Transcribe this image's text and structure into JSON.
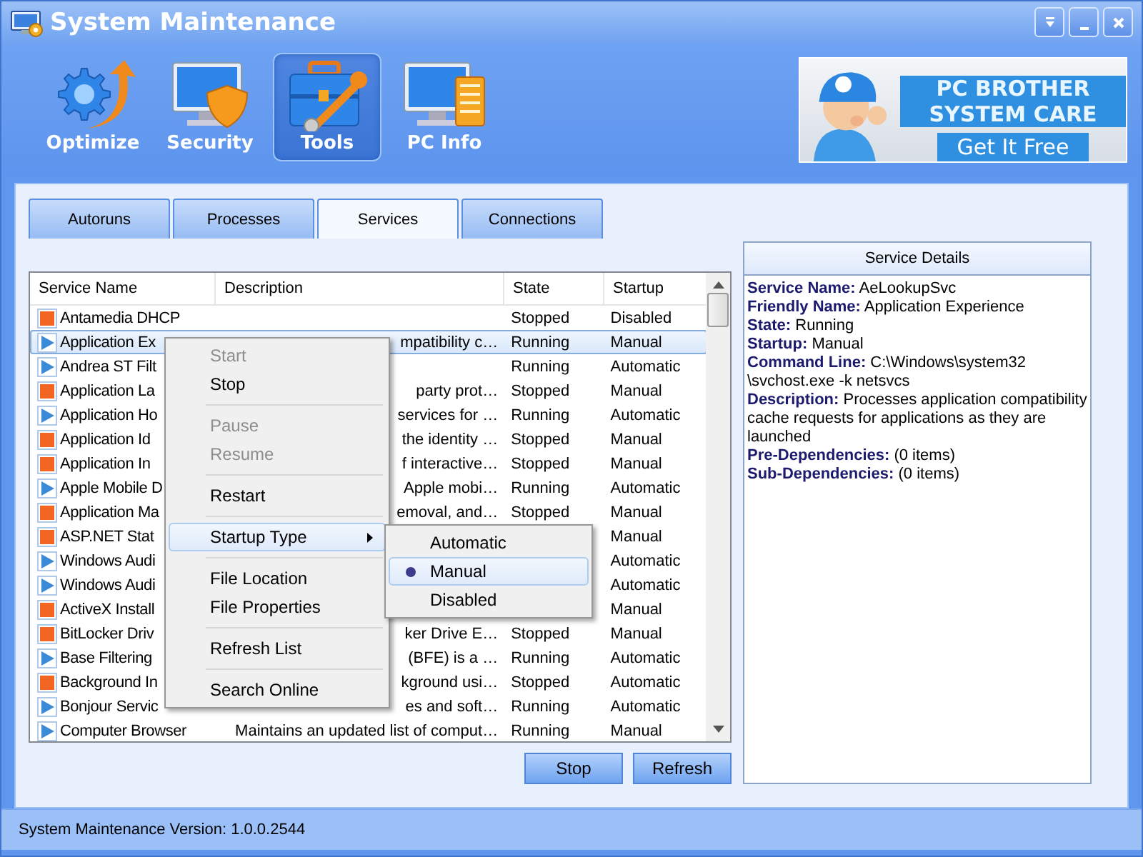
{
  "window": {
    "title": "System Maintenance"
  },
  "nav": [
    {
      "label": "Optimize",
      "kind": "optimize",
      "selected": false
    },
    {
      "label": "Security",
      "kind": "security",
      "selected": false
    },
    {
      "label": "Tools",
      "kind": "tools",
      "selected": true
    },
    {
      "label": "PC Info",
      "kind": "info",
      "selected": false
    }
  ],
  "banner": {
    "title_lines": [
      "PC BROTHER",
      "SYSTEM CARE"
    ],
    "action": "Get It Free"
  },
  "tabs": [
    {
      "label": "Autoruns",
      "selected": false
    },
    {
      "label": "Processes",
      "selected": false
    },
    {
      "label": "Services",
      "selected": true
    },
    {
      "label": "Connections",
      "selected": false
    }
  ],
  "table": {
    "columns": [
      "Service Name",
      "Description",
      "State",
      "Startup"
    ],
    "rows": [
      {
        "running": false,
        "selected": false,
        "name": "Antamedia DHCP",
        "state": "Stopped",
        "startup": "Disabled"
      },
      {
        "running": true,
        "selected": true,
        "name": "Application Ex",
        "description": "mpatibility c…",
        "state": "Running",
        "startup": "Manual"
      },
      {
        "running": true,
        "selected": false,
        "name": "Andrea ST Filt",
        "state": "Running",
        "startup": "Automatic"
      },
      {
        "running": false,
        "selected": false,
        "name": "Application La",
        "description": "party prot…",
        "state": "Stopped",
        "startup": "Manual"
      },
      {
        "running": true,
        "selected": false,
        "name": "Application Ho",
        "description": "services for …",
        "state": "Running",
        "startup": "Automatic"
      },
      {
        "running": false,
        "selected": false,
        "name": "Application Id",
        "description": "the identity …",
        "state": "Stopped",
        "startup": "Manual"
      },
      {
        "running": false,
        "selected": false,
        "name": "Application In",
        "description": "f interactive…",
        "state": "Stopped",
        "startup": "Manual"
      },
      {
        "running": true,
        "selected": false,
        "name": "Apple Mobile D",
        "description": "Apple mobi…",
        "state": "Running",
        "startup": "Automatic"
      },
      {
        "running": false,
        "selected": false,
        "name": "Application Ma",
        "description": "emoval, and…",
        "state": "Stopped",
        "startup": "Manual"
      },
      {
        "running": false,
        "selected": false,
        "name": "ASP.NET Stat",
        "startup": "Manual"
      },
      {
        "running": true,
        "selected": false,
        "name": "Windows Audi",
        "startup": "Automatic"
      },
      {
        "running": true,
        "selected": false,
        "name": "Windows Audi",
        "startup": "Automatic"
      },
      {
        "running": false,
        "selected": false,
        "name": "ActiveX Install",
        "startup": "Manual"
      },
      {
        "running": false,
        "selected": false,
        "name": "BitLocker Driv",
        "description": "ker Drive E…",
        "state": "Stopped",
        "startup": "Manual"
      },
      {
        "running": true,
        "selected": false,
        "name": "Base Filtering",
        "description": "(BFE) is a …",
        "state": "Running",
        "startup": "Automatic"
      },
      {
        "running": false,
        "selected": false,
        "name": "Background In",
        "description": "kground usi…",
        "state": "Stopped",
        "startup": "Automatic"
      },
      {
        "running": true,
        "selected": false,
        "name": "Bonjour Servic",
        "description": "es and soft…",
        "state": "Running",
        "startup": "Automatic"
      },
      {
        "running": true,
        "selected": false,
        "name": "Computer Browser",
        "description": "Maintains an updated list of comput…",
        "state": "Running",
        "startup": "Manual"
      }
    ]
  },
  "context_menu": {
    "items": [
      {
        "kind": "item",
        "label": "Start",
        "disabled": true,
        "highlighted": false
      },
      {
        "kind": "item",
        "label": "Stop",
        "disabled": false,
        "highlighted": false
      },
      {
        "kind": "separator"
      },
      {
        "kind": "item",
        "label": "Pause",
        "disabled": true,
        "highlighted": false
      },
      {
        "kind": "item",
        "label": "Resume",
        "disabled": true,
        "highlighted": false
      },
      {
        "kind": "separator"
      },
      {
        "kind": "item",
        "label": "Restart",
        "disabled": false,
        "highlighted": false
      },
      {
        "kind": "separator"
      },
      {
        "kind": "submenu",
        "label": "Startup Type",
        "disabled": false,
        "highlighted": true
      },
      {
        "kind": "separator"
      },
      {
        "kind": "item",
        "label": "File Location",
        "disabled": false,
        "highlighted": false
      },
      {
        "kind": "item",
        "label": "File Properties",
        "disabled": false,
        "highlighted": false
      },
      {
        "kind": "separator"
      },
      {
        "kind": "item",
        "label": "Refresh List",
        "disabled": false,
        "highlighted": false
      },
      {
        "kind": "separator"
      },
      {
        "kind": "item",
        "label": "Search Online",
        "disabled": false,
        "highlighted": false
      }
    ]
  },
  "submenu": {
    "items": [
      {
        "label": "Automatic",
        "checked": false,
        "highlighted": false
      },
      {
        "label": "Manual",
        "checked": true,
        "highlighted": true
      },
      {
        "label": "Disabled",
        "checked": false,
        "highlighted": false
      }
    ]
  },
  "details": {
    "title": "Service Details",
    "lines": [
      "**Service Name:** AeLookupSvc",
      "**Friendly Name:** Application Experience",
      "**State:** Running",
      "**Startup:** Manual",
      "**Command Line:** C:\\Windows\\system32 \\svchost.exe -k netsvcs",
      "**Description:** Processes application compatibility cache requests for applications as they are launched",
      "**Pre-Dependencies:** (0 items)",
      "**Sub-Dependencies:** (0 items)"
    ]
  },
  "buttons": [
    "Stop",
    "Refresh"
  ],
  "status_bar": "System Maintenance Version: 1.0.0.2544"
}
